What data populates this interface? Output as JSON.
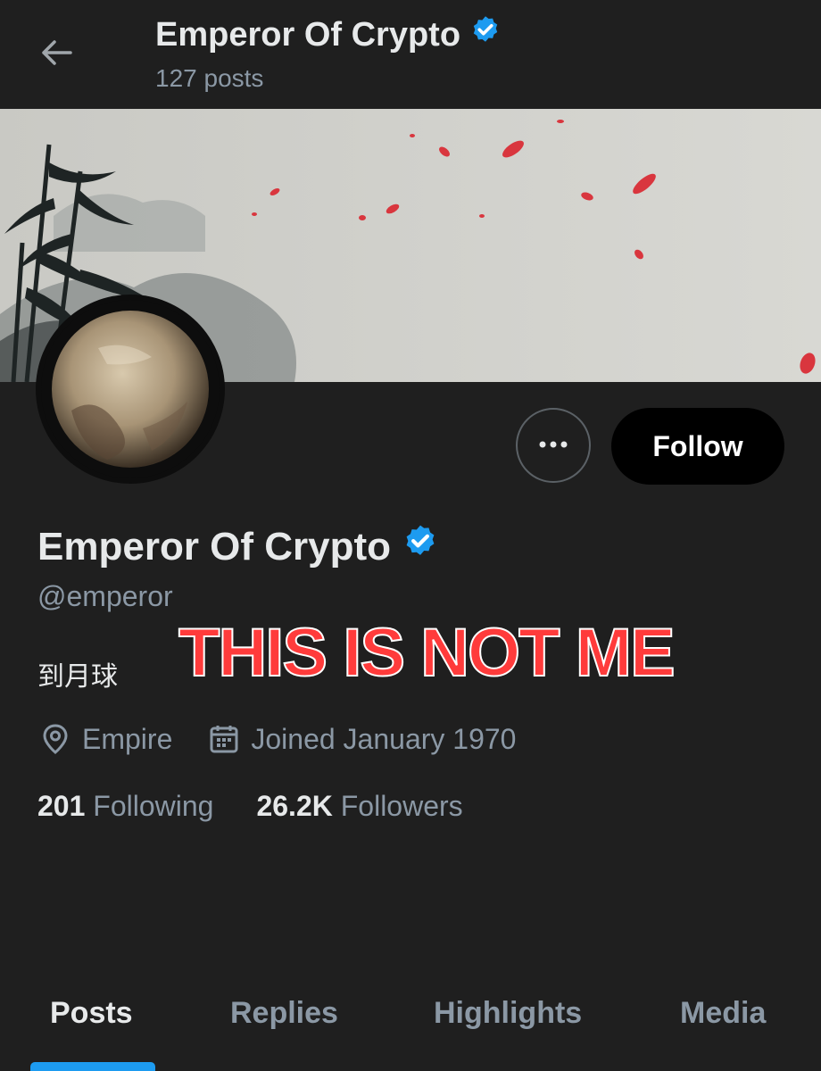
{
  "header": {
    "title": "Emperor Of Crypto",
    "posts_count": "127 posts",
    "back_icon": "arrow-left-icon",
    "verified_icon": "verified-badge-icon"
  },
  "profile": {
    "display_name": "Emperor Of Crypto",
    "handle": "@emperor",
    "bio": "到月球",
    "location": "Empire",
    "joined": "Joined January 1970",
    "following_count": "201",
    "following_label": "Following",
    "followers_count": "26.2K",
    "followers_label": "Followers"
  },
  "actions": {
    "more_icon": "more-horizontal-icon",
    "follow_label": "Follow"
  },
  "overlay": {
    "text": "THIS IS NOT ME"
  },
  "tabs": [
    {
      "label": "Posts",
      "active": true
    },
    {
      "label": "Replies",
      "active": false
    },
    {
      "label": "Highlights",
      "active": false
    },
    {
      "label": "Media",
      "active": false
    }
  ],
  "colors": {
    "background": "#1f1f1f",
    "verified": "#1d9bf0",
    "secondary_text": "#8b98a5",
    "overlay_red": "#ff3b3b"
  }
}
